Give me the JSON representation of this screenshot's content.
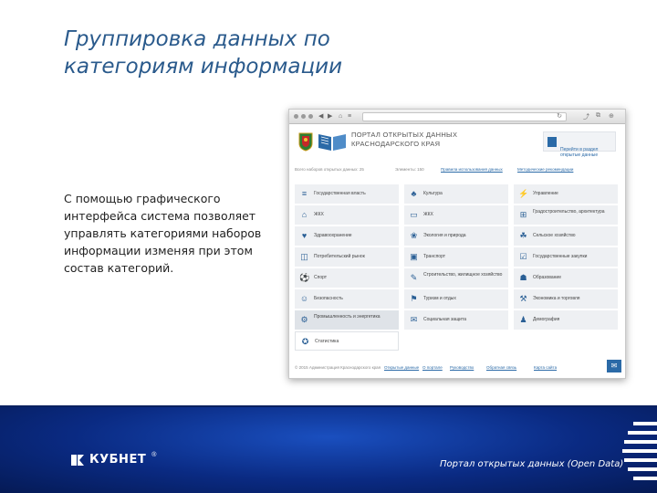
{
  "slide": {
    "title": "Группировка данных по\nкатегориям информации",
    "body": "С помощью графического интерфейса система позволяет управлять категориями наборов информации изменяя при этом состав категорий."
  },
  "browser": {
    "nav_back": "◀",
    "nav_forward": "▶",
    "nav_home": "⌂",
    "nav_list": "≡",
    "reload_icon": "↻",
    "bar_right_icons": [
      "⤴",
      "⧉",
      "⊕"
    ]
  },
  "site": {
    "portal_title": "Портал открытых данных\nКраснодарского края",
    "header_button": "Перейти в раздел\nоткрытые данные",
    "info": {
      "total_sets": "Всего наборов открытых данных: 25",
      "elements": "Элементы: 150",
      "link_rules": "Правила использования данных",
      "link_methods": "Методические рекомендации"
    },
    "categories": [
      {
        "label": "Государственная власть",
        "icon": "≡",
        "icon_name": "government-icon"
      },
      {
        "label": "Культура",
        "icon": "♣",
        "icon_name": "culture-icon"
      },
      {
        "label": "Управление",
        "icon": "⚡",
        "icon_name": "management-icon"
      },
      {
        "label": "ЖКХ",
        "icon": "⌂",
        "icon_name": "housing-icon"
      },
      {
        "label": "ЖКХ",
        "icon": "▭",
        "icon_name": "housing-card-icon"
      },
      {
        "label": "Градостроительство, архитектура",
        "icon": "⊞",
        "icon_name": "architecture-icon"
      },
      {
        "label": "Здравоохранение",
        "icon": "♥",
        "icon_name": "health-icon"
      },
      {
        "label": "Экология и природа",
        "icon": "❀",
        "icon_name": "ecology-icon"
      },
      {
        "label": "Сельское хозяйство",
        "icon": "☘",
        "icon_name": "agriculture-icon"
      },
      {
        "label": "Потребительский рынок",
        "icon": "◫",
        "icon_name": "market-icon"
      },
      {
        "label": "Транспорт",
        "icon": "▣",
        "icon_name": "transport-icon"
      },
      {
        "label": "Государственные закупки",
        "icon": "☑",
        "icon_name": "procurement-icon"
      },
      {
        "label": "Спорт",
        "icon": "⚽",
        "icon_name": "sport-icon"
      },
      {
        "label": "Строительство, жилищное хозяйство",
        "icon": "✎",
        "icon_name": "construction-icon"
      },
      {
        "label": "Образование",
        "icon": "☗",
        "icon_name": "education-icon"
      },
      {
        "label": "Безопасность",
        "icon": "☺",
        "icon_name": "security-icon"
      },
      {
        "label": "Туризм и отдых",
        "icon": "⚑",
        "icon_name": "tourism-icon"
      },
      {
        "label": "Экономика и торговля",
        "icon": "⚒",
        "icon_name": "economy-icon"
      },
      {
        "label": "Промышленность и энергетика",
        "icon": "⚙",
        "icon_name": "industry-icon"
      },
      {
        "label": "Социальная защита",
        "icon": "✉",
        "icon_name": "social-icon"
      },
      {
        "label": "Демография",
        "icon": "♟",
        "icon_name": "demography-icon"
      },
      {
        "label": "Статистика",
        "icon": "✪",
        "icon_name": "statistics-icon"
      }
    ],
    "footer": {
      "copyright": "© 2015 Администрация Краснодарского края",
      "links": [
        "Открытые данные",
        "О портале",
        "Руководство",
        "Обратная связь",
        "Карта сайта"
      ],
      "mail_icon": "✉"
    }
  },
  "band": {
    "logo_text": "КУБНЕТ",
    "logo_reg": "®",
    "caption": "Портал открытых данных (Open Data)"
  },
  "colors": {
    "title": "#2a5a8c",
    "accent": "#2b6aa7",
    "band": "#0a2a82"
  }
}
